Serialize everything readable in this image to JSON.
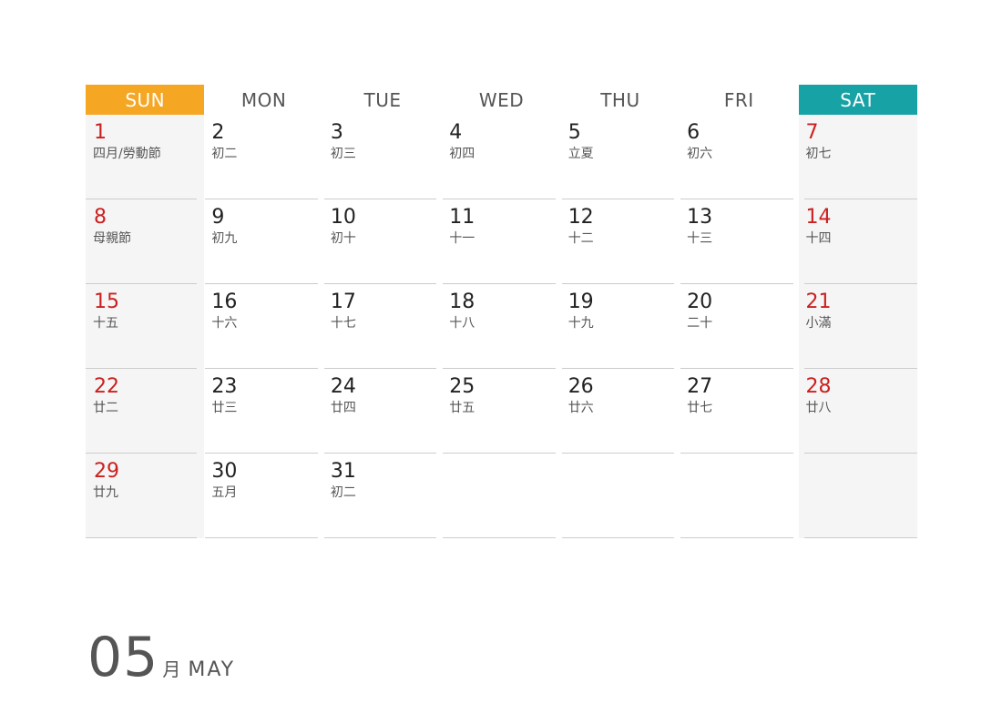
{
  "calendar": {
    "headers": [
      "SUN",
      "MON",
      "TUE",
      "WED",
      "THU",
      "FRI",
      "SAT"
    ],
    "colors": {
      "sunday_header": "#f5a623",
      "saturday_header": "#17a2a6",
      "holiday_red": "#cc1f1f",
      "weekend_bg": "#f5f5f5"
    },
    "weeks": [
      [
        {
          "day": "1",
          "lunar": "四月/勞動節",
          "red": true
        },
        {
          "day": "2",
          "lunar": "初二",
          "red": false
        },
        {
          "day": "3",
          "lunar": "初三",
          "red": false
        },
        {
          "day": "4",
          "lunar": "初四",
          "red": false
        },
        {
          "day": "5",
          "lunar": "立夏",
          "red": false
        },
        {
          "day": "6",
          "lunar": "初六",
          "red": false
        },
        {
          "day": "7",
          "lunar": "初七",
          "red": true
        }
      ],
      [
        {
          "day": "8",
          "lunar": "母親節",
          "red": true
        },
        {
          "day": "9",
          "lunar": "初九",
          "red": false
        },
        {
          "day": "10",
          "lunar": "初十",
          "red": false
        },
        {
          "day": "11",
          "lunar": "十一",
          "red": false
        },
        {
          "day": "12",
          "lunar": "十二",
          "red": false
        },
        {
          "day": "13",
          "lunar": "十三",
          "red": false
        },
        {
          "day": "14",
          "lunar": "十四",
          "red": true
        }
      ],
      [
        {
          "day": "15",
          "lunar": "十五",
          "red": true
        },
        {
          "day": "16",
          "lunar": "十六",
          "red": false
        },
        {
          "day": "17",
          "lunar": "十七",
          "red": false
        },
        {
          "day": "18",
          "lunar": "十八",
          "red": false
        },
        {
          "day": "19",
          "lunar": "十九",
          "red": false
        },
        {
          "day": "20",
          "lunar": "二十",
          "red": false
        },
        {
          "day": "21",
          "lunar": "小滿",
          "red": true
        }
      ],
      [
        {
          "day": "22",
          "lunar": "廿二",
          "red": true
        },
        {
          "day": "23",
          "lunar": "廿三",
          "red": false
        },
        {
          "day": "24",
          "lunar": "廿四",
          "red": false
        },
        {
          "day": "25",
          "lunar": "廿五",
          "red": false
        },
        {
          "day": "26",
          "lunar": "廿六",
          "red": false
        },
        {
          "day": "27",
          "lunar": "廿七",
          "red": false
        },
        {
          "day": "28",
          "lunar": "廿八",
          "red": true
        }
      ],
      [
        {
          "day": "29",
          "lunar": "廿九",
          "red": true
        },
        {
          "day": "30",
          "lunar": "五月",
          "red": false
        },
        {
          "day": "31",
          "lunar": "初二",
          "red": false
        },
        {
          "day": "",
          "lunar": "",
          "red": false
        },
        {
          "day": "",
          "lunar": "",
          "red": false
        },
        {
          "day": "",
          "lunar": "",
          "red": false
        },
        {
          "day": "",
          "lunar": "",
          "red": false
        }
      ]
    ]
  },
  "month": {
    "number": "05",
    "chinese": "月",
    "english": "MAY"
  }
}
